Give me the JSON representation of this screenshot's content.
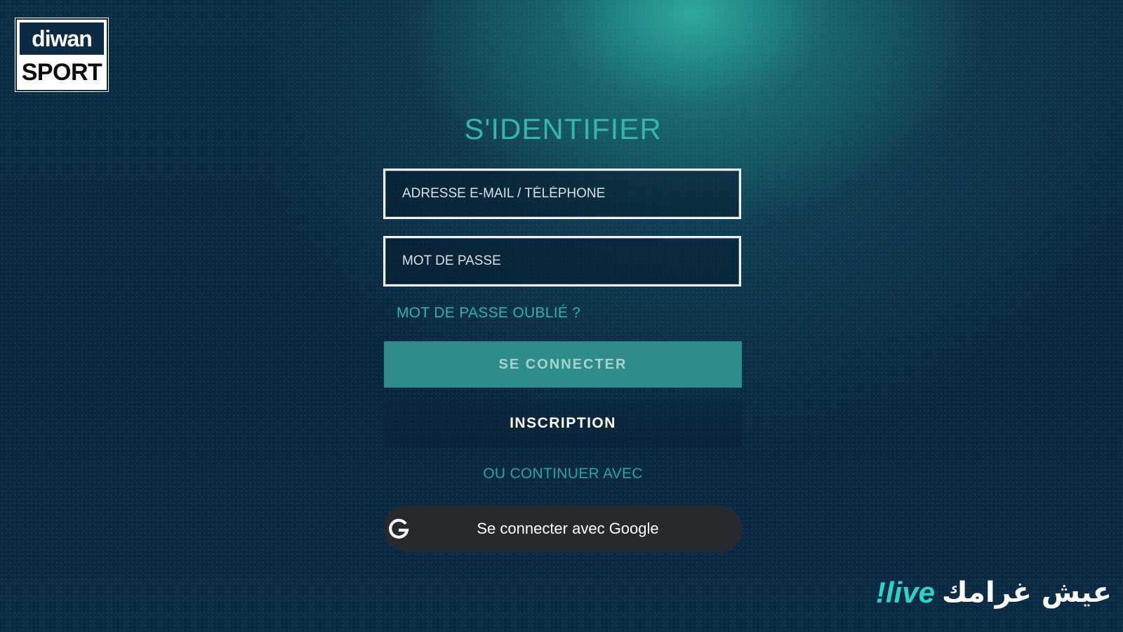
{
  "brand": {
    "logo_top": "diwan",
    "logo_bottom": "SPORT"
  },
  "login": {
    "title": "S'IDENTIFIER",
    "email_placeholder": "ADRESSE E-MAIL / TÉLÉPHONE",
    "email_value": "",
    "password_placeholder": "MOT DE PASSE",
    "password_value": "",
    "forgot_password": "MOT DE PASSE OUBLIÉ ?",
    "connect_button": "SE CONNECTER",
    "signup_button": "INSCRIPTION",
    "or_continue": "OU CONTINUER AVEC",
    "google_button": "Se connecter avec Google",
    "google_icon": "google-g-icon"
  },
  "slogan": {
    "live": "!live",
    "arabic": "عيش غرامك"
  },
  "colors": {
    "accent": "#33b7aa",
    "button_bg": "#2e8d8a",
    "background": "#0b2a44",
    "google_button_bg": "#262a2e"
  }
}
